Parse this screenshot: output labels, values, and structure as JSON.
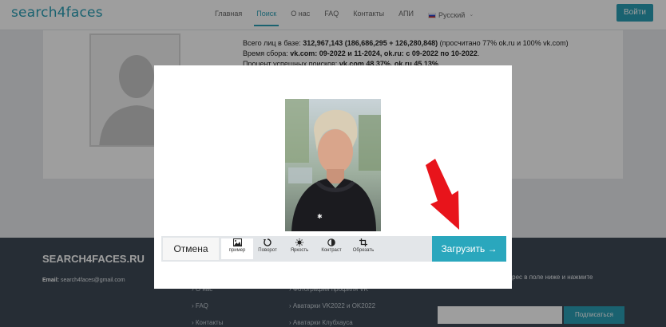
{
  "header": {
    "logo": "search4faces",
    "nav": [
      "Главная",
      "Поиск",
      "О нас",
      "FAQ",
      "Контакты",
      "АПИ"
    ],
    "active_nav": "Поиск",
    "language": "Русский",
    "login_label": "Войти"
  },
  "stats": {
    "line1_prefix": "Всего лиц в базе: ",
    "line1_bold": "312,967,143 (186,686,295 + 126,280,848)",
    "line1_suffix": " (просчитано 77% ok.ru и 100% vk.com)",
    "line2_prefix": "Время сбора: ",
    "line2_bold": "vk.com: 09-2022 и 11-2024, ok.ru: с 09-2022 по 10-2022",
    "line2_suffix": ".",
    "line3_prefix": "Процент успешных поисков: ",
    "line3_bold": "vk.com 48.37%, ok.ru 45.13%"
  },
  "footer": {
    "title": "SEARCH4FACES.RU",
    "email_label": "Email:",
    "email_value": "search4faces@gmail.com",
    "links_col1": [
      "О нас",
      "FAQ",
      "Контакты"
    ],
    "links_col2": [
      "Фотографии профиля VK",
      "Аватарки VK2022 и OK2022",
      "Аватарки Клубхауса"
    ],
    "right_text_1": "...",
    "right_text_2": "адрес в поле ниже и нажмите",
    "subscribe_label": "Подписаться"
  },
  "modal": {
    "cancel_label": "Отмена",
    "tools": [
      {
        "label": "пример",
        "icon": "image-icon"
      },
      {
        "label": "Поворот",
        "icon": "rotate-icon"
      },
      {
        "label": "Яркость",
        "icon": "brightness-icon"
      },
      {
        "label": "Контраст",
        "icon": "contrast-icon"
      },
      {
        "label": "Обрезать",
        "icon": "crop-icon"
      }
    ],
    "upload_label": "Загрузить →"
  },
  "colors": {
    "accent": "#2a9fb5",
    "footer_bg": "#3e4a56",
    "arrow": "#e8141b"
  }
}
